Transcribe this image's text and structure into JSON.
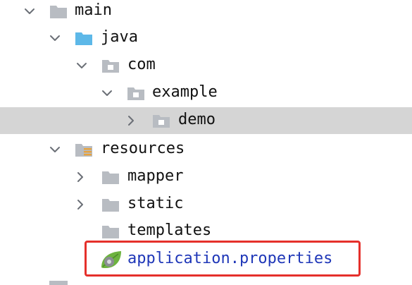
{
  "tree": {
    "items": [
      {
        "label": "main",
        "expanded": true,
        "icon": "folder-icon"
      },
      {
        "label": "java",
        "expanded": true,
        "icon": "source-folder-icon"
      },
      {
        "label": "com",
        "expanded": true,
        "icon": "package-icon"
      },
      {
        "label": "example",
        "expanded": true,
        "icon": "package-icon"
      },
      {
        "label": "demo",
        "expanded": false,
        "icon": "package-icon",
        "selected": true
      },
      {
        "label": "resources",
        "expanded": true,
        "icon": "resources-folder-icon"
      },
      {
        "label": "mapper",
        "expanded": false,
        "icon": "folder-icon"
      },
      {
        "label": "static",
        "expanded": false,
        "icon": "folder-icon"
      },
      {
        "label": "templates",
        "icon": "folder-icon"
      },
      {
        "label": "application.properties",
        "icon": "spring-leaf-icon",
        "highlighted": true
      }
    ]
  },
  "colors": {
    "selection": "#d5d5d5",
    "highlight_border": "#e5302b",
    "properties_text": "#1f37b8",
    "folder_gray": "#b8bcc2",
    "folder_blue": "#5db8e8",
    "spring_green": "#6db33f"
  }
}
